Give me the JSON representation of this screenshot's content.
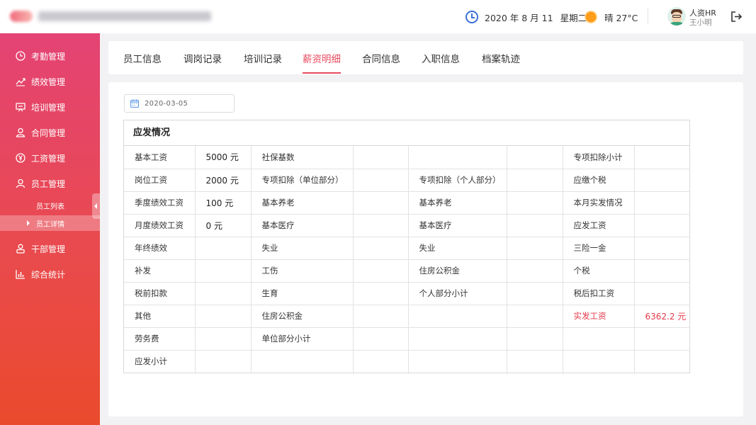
{
  "header": {
    "date": "2020 年 8 月 11",
    "weekday": "星期二",
    "weather": "晴 27°C",
    "user_role": "人资HR",
    "user_name": "王小明",
    "colors": {
      "accent": "#3b6fd8",
      "sun": "#ff9c1a"
    }
  },
  "sidebar": {
    "items": [
      {
        "label": "考勤管理",
        "icon": "clock-icon"
      },
      {
        "label": "绩效管理",
        "icon": "trend-icon"
      },
      {
        "label": "培训管理",
        "icon": "presentation-icon"
      },
      {
        "label": "合同管理",
        "icon": "user-icon"
      },
      {
        "label": "工资管理",
        "icon": "yen-icon"
      },
      {
        "label": "员工管理",
        "icon": "person-icon"
      },
      {
        "label": "干部管理",
        "icon": "cadre-icon"
      },
      {
        "label": "综合统计",
        "icon": "bar-chart-icon"
      }
    ],
    "sub_items": [
      {
        "label": "员工列表",
        "active": false
      },
      {
        "label": "员工详情",
        "active": true
      }
    ],
    "colors": {
      "top": "#e44374",
      "bottom": "#ea4a2c"
    }
  },
  "tabs": [
    {
      "label": "员工信息",
      "active": false
    },
    {
      "label": "调岗记录",
      "active": false
    },
    {
      "label": "培训记录",
      "active": false
    },
    {
      "label": "薪资明细",
      "active": true
    },
    {
      "label": "合同信息",
      "active": false
    },
    {
      "label": "入职信息",
      "active": false
    },
    {
      "label": "档案轨迹",
      "active": false
    }
  ],
  "date_picker": {
    "value": "2020-03-05"
  },
  "salary": {
    "title": "应发情况",
    "rows": [
      [
        "基本工资",
        "5000 元",
        "社保基数",
        "",
        "",
        "",
        "专项扣除小计",
        ""
      ],
      [
        "岗位工资",
        "2000 元",
        "专项扣除（单位部分）",
        "",
        "专项扣除（个人部分）",
        "",
        "应缴个税",
        ""
      ],
      [
        "季度绩效工资",
        "100 元",
        "基本养老",
        "",
        "基本养老",
        "",
        "本月实发情况",
        ""
      ],
      [
        "月度绩效工资",
        "0 元",
        "基本医疗",
        "",
        "基本医疗",
        "",
        "应发工资",
        ""
      ],
      [
        "年终绩效",
        "",
        "失业",
        "",
        "失业",
        "",
        "三险一金",
        ""
      ],
      [
        "补发",
        "",
        "工伤",
        "",
        "住房公积金",
        "",
        "个税",
        ""
      ],
      [
        "税前扣款",
        "",
        "生育",
        "",
        "个人部分小计",
        "",
        "税后扣工资",
        ""
      ],
      [
        "其他",
        "",
        "住房公积金",
        "",
        "",
        "",
        "实发工资",
        "6362.2 元"
      ],
      [
        "劳务费",
        "",
        "单位部分小计",
        "",
        "",
        "",
        "",
        ""
      ],
      [
        "应发小计",
        "",
        "",
        "",
        "",
        "",
        "",
        ""
      ]
    ],
    "highlight_color": "#e3394a"
  }
}
